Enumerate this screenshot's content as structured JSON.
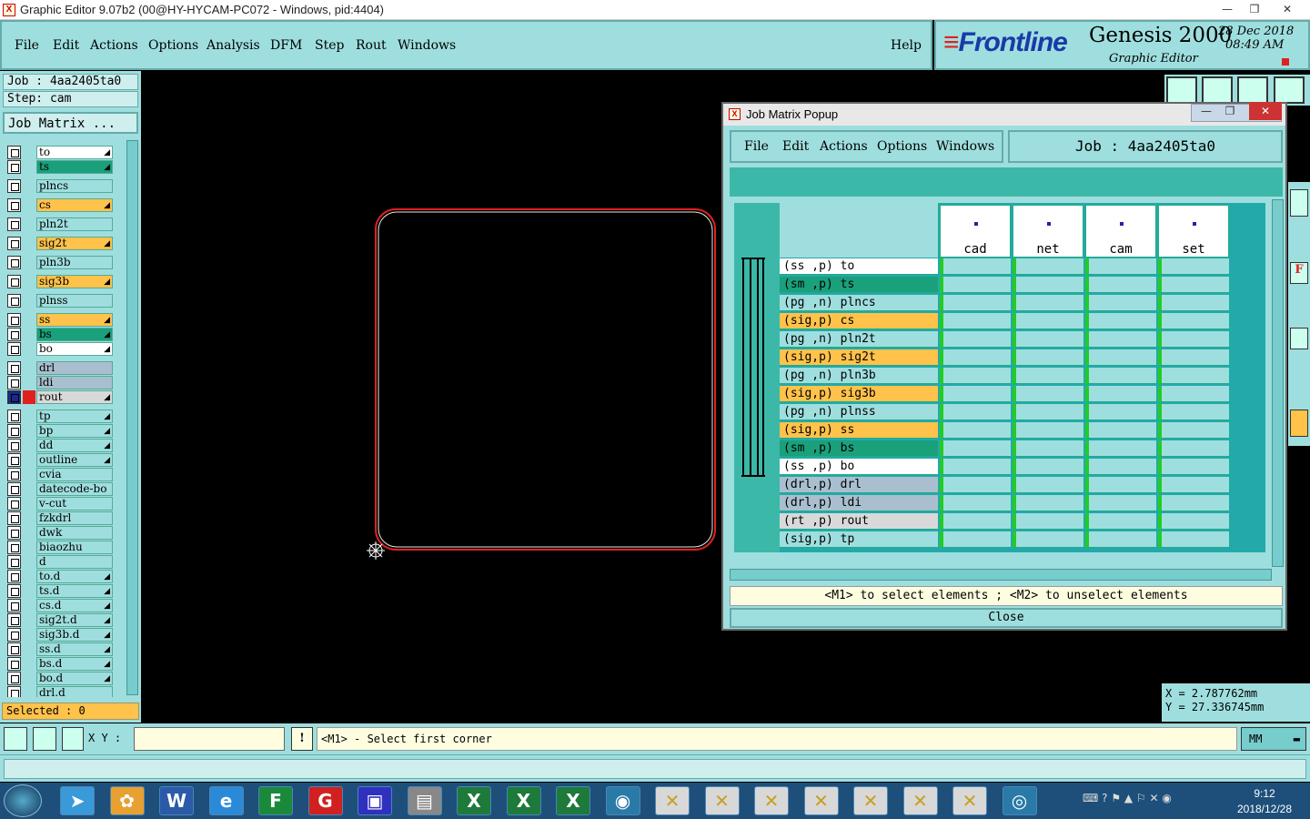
{
  "window": {
    "title": "Graphic Editor 9.07b2 (00@HY-HYCAM-PC072 - Windows, pid:4404)",
    "icon": "X"
  },
  "menu": {
    "items": [
      "File",
      "Edit",
      "Actions",
      "Options",
      "Analysis",
      "DFM",
      "Step",
      "Rout",
      "Windows"
    ],
    "help": "Help"
  },
  "brand": {
    "logo": "Frontline",
    "logo_f": "F",
    "product": "Genesis 2000",
    "subtitle": "Graphic Editor",
    "date": "28 Dec 2018",
    "time": "08:49  AM"
  },
  "left": {
    "job": "Job : 4aa2405ta0",
    "step": "Step: cam",
    "job_matrix": "Job Matrix ...",
    "selected": "Selected : 0",
    "layers": [
      {
        "name": "to",
        "bg": "#ffffff",
        "arrow": true
      },
      {
        "name": "ts",
        "bg": "#1aa07a",
        "arrow": true
      },
      {
        "name": "plncs",
        "bg": "#9fdede",
        "arrow": false
      },
      {
        "name": "cs",
        "bg": "#ffc24a",
        "arrow": true
      },
      {
        "name": "pln2t",
        "bg": "#9fdede",
        "arrow": false
      },
      {
        "name": "sig2t",
        "bg": "#ffc24a",
        "arrow": true
      },
      {
        "name": "pln3b",
        "bg": "#9fdede",
        "arrow": false
      },
      {
        "name": "sig3b",
        "bg": "#ffc24a",
        "arrow": true
      },
      {
        "name": "plnss",
        "bg": "#9fdede",
        "arrow": false
      },
      {
        "name": "ss",
        "bg": "#ffc24a",
        "arrow": true
      },
      {
        "name": "bs",
        "bg": "#1aa07a",
        "arrow": true
      },
      {
        "name": "bo",
        "bg": "#ffffff",
        "arrow": true
      },
      {
        "name": "drl",
        "bg": "#a9bfcf",
        "arrow": false
      },
      {
        "name": "ldi",
        "bg": "#a9bfcf",
        "arrow": false
      },
      {
        "name": "rout",
        "bg": "#d9d9d9",
        "arrow": true
      },
      {
        "name": "tp",
        "bg": "#9fdede",
        "arrow": true
      },
      {
        "name": "bp",
        "bg": "#9fdede",
        "arrow": true
      },
      {
        "name": "dd",
        "bg": "#9fdede",
        "arrow": true
      },
      {
        "name": "outline",
        "bg": "#9fdede",
        "arrow": true
      },
      {
        "name": "cvia",
        "bg": "#9fdede",
        "arrow": false
      },
      {
        "name": "datecode-bo",
        "bg": "#9fdede",
        "arrow": false
      },
      {
        "name": "v-cut",
        "bg": "#9fdede",
        "arrow": false
      },
      {
        "name": "fzkdrl",
        "bg": "#9fdede",
        "arrow": false
      },
      {
        "name": "dwk",
        "bg": "#9fdede",
        "arrow": false
      },
      {
        "name": "biaozhu",
        "bg": "#9fdede",
        "arrow": false
      },
      {
        "name": "d",
        "bg": "#9fdede",
        "arrow": false
      },
      {
        "name": "to.d",
        "bg": "#9fdede",
        "arrow": true
      },
      {
        "name": "ts.d",
        "bg": "#9fdede",
        "arrow": true
      },
      {
        "name": "cs.d",
        "bg": "#9fdede",
        "arrow": true
      },
      {
        "name": "sig2t.d",
        "bg": "#9fdede",
        "arrow": true
      },
      {
        "name": "sig3b.d",
        "bg": "#9fdede",
        "arrow": true
      },
      {
        "name": "ss.d",
        "bg": "#9fdede",
        "arrow": true
      },
      {
        "name": "bs.d",
        "bg": "#9fdede",
        "arrow": true
      },
      {
        "name": "bo.d",
        "bg": "#9fdede",
        "arrow": true
      },
      {
        "name": "drl.d",
        "bg": "#9fdede",
        "arrow": false
      }
    ]
  },
  "popup": {
    "title": "Job Matrix Popup",
    "menu": [
      "File",
      "Edit",
      "Actions",
      "Options",
      "Windows"
    ],
    "job": "Job : 4aa2405ta0",
    "steps": [
      "cad",
      "net",
      "cam",
      "set"
    ],
    "rows": [
      {
        "label": "(ss ,p) to",
        "bg": "#ffffff"
      },
      {
        "label": "(sm ,p) ts",
        "bg": "#1aa07a"
      },
      {
        "label": "(pg ,n) plncs",
        "bg": "#9fdede"
      },
      {
        "label": "(sig,p) cs",
        "bg": "#ffc24a"
      },
      {
        "label": "(pg ,n) pln2t",
        "bg": "#9fdede"
      },
      {
        "label": "(sig,p) sig2t",
        "bg": "#ffc24a"
      },
      {
        "label": "(pg ,n) pln3b",
        "bg": "#9fdede"
      },
      {
        "label": "(sig,p) sig3b",
        "bg": "#ffc24a"
      },
      {
        "label": "(pg ,n) plnss",
        "bg": "#9fdede"
      },
      {
        "label": "(sig,p) ss",
        "bg": "#ffc24a"
      },
      {
        "label": "(sm ,p) bs",
        "bg": "#1aa07a"
      },
      {
        "label": "(ss ,p) bo",
        "bg": "#ffffff"
      },
      {
        "label": "(drl,p) drl",
        "bg": "#a9bfcf"
      },
      {
        "label": "(drl,p) ldi",
        "bg": "#a9bfcf"
      },
      {
        "label": "(rt ,p) rout",
        "bg": "#d9d9d9"
      },
      {
        "label": "(sig,p) tp",
        "bg": "#9fdede"
      }
    ],
    "hint": "<M1> to select elements ; <M2> to unselect elements",
    "close": "Close"
  },
  "coords": {
    "x": "X = 2.787762mm",
    "y": "Y = 27.336745mm"
  },
  "bottom": {
    "xy_label": "X Y :",
    "prompt": "<M1> - Select first corner",
    "units": "MM"
  },
  "tray": {
    "time": "9:12",
    "date": "2018/12/28"
  }
}
